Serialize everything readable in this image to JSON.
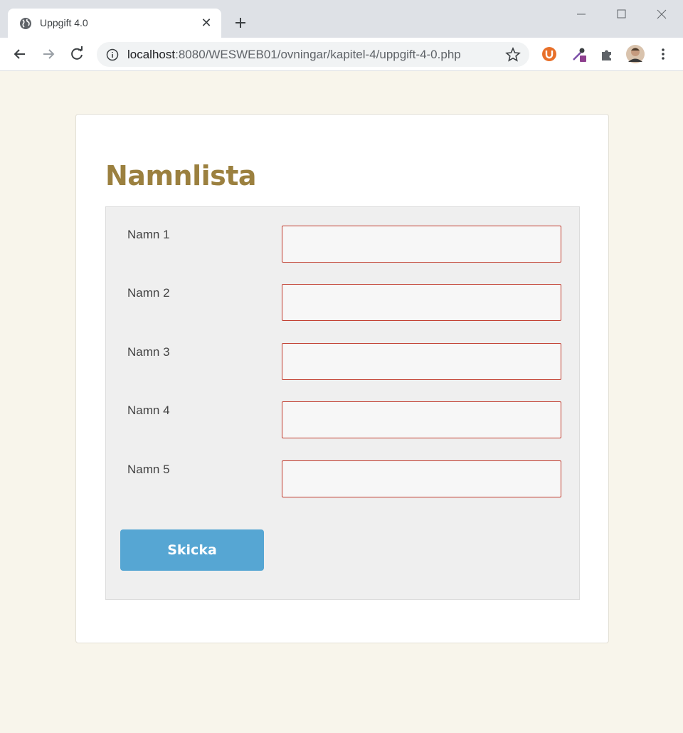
{
  "browser": {
    "tab_title": "Uppgift 4.0",
    "tab_close": "✕",
    "url_host": "localhost",
    "url_path": ":8080/WESWEB01/ovningar/kapitel-4/uppgift-4-0.php"
  },
  "page": {
    "heading": "Namnlista",
    "fields": [
      {
        "label": "Namn 1",
        "value": ""
      },
      {
        "label": "Namn 2",
        "value": ""
      },
      {
        "label": "Namn 3",
        "value": ""
      },
      {
        "label": "Namn 4",
        "value": ""
      },
      {
        "label": "Namn 5",
        "value": ""
      }
    ],
    "submit_label": "Skicka"
  },
  "colors": {
    "page_bg": "#f8f5eb",
    "heading": "#9b803f",
    "input_border": "#c0392b",
    "button": "#56a6d3"
  }
}
